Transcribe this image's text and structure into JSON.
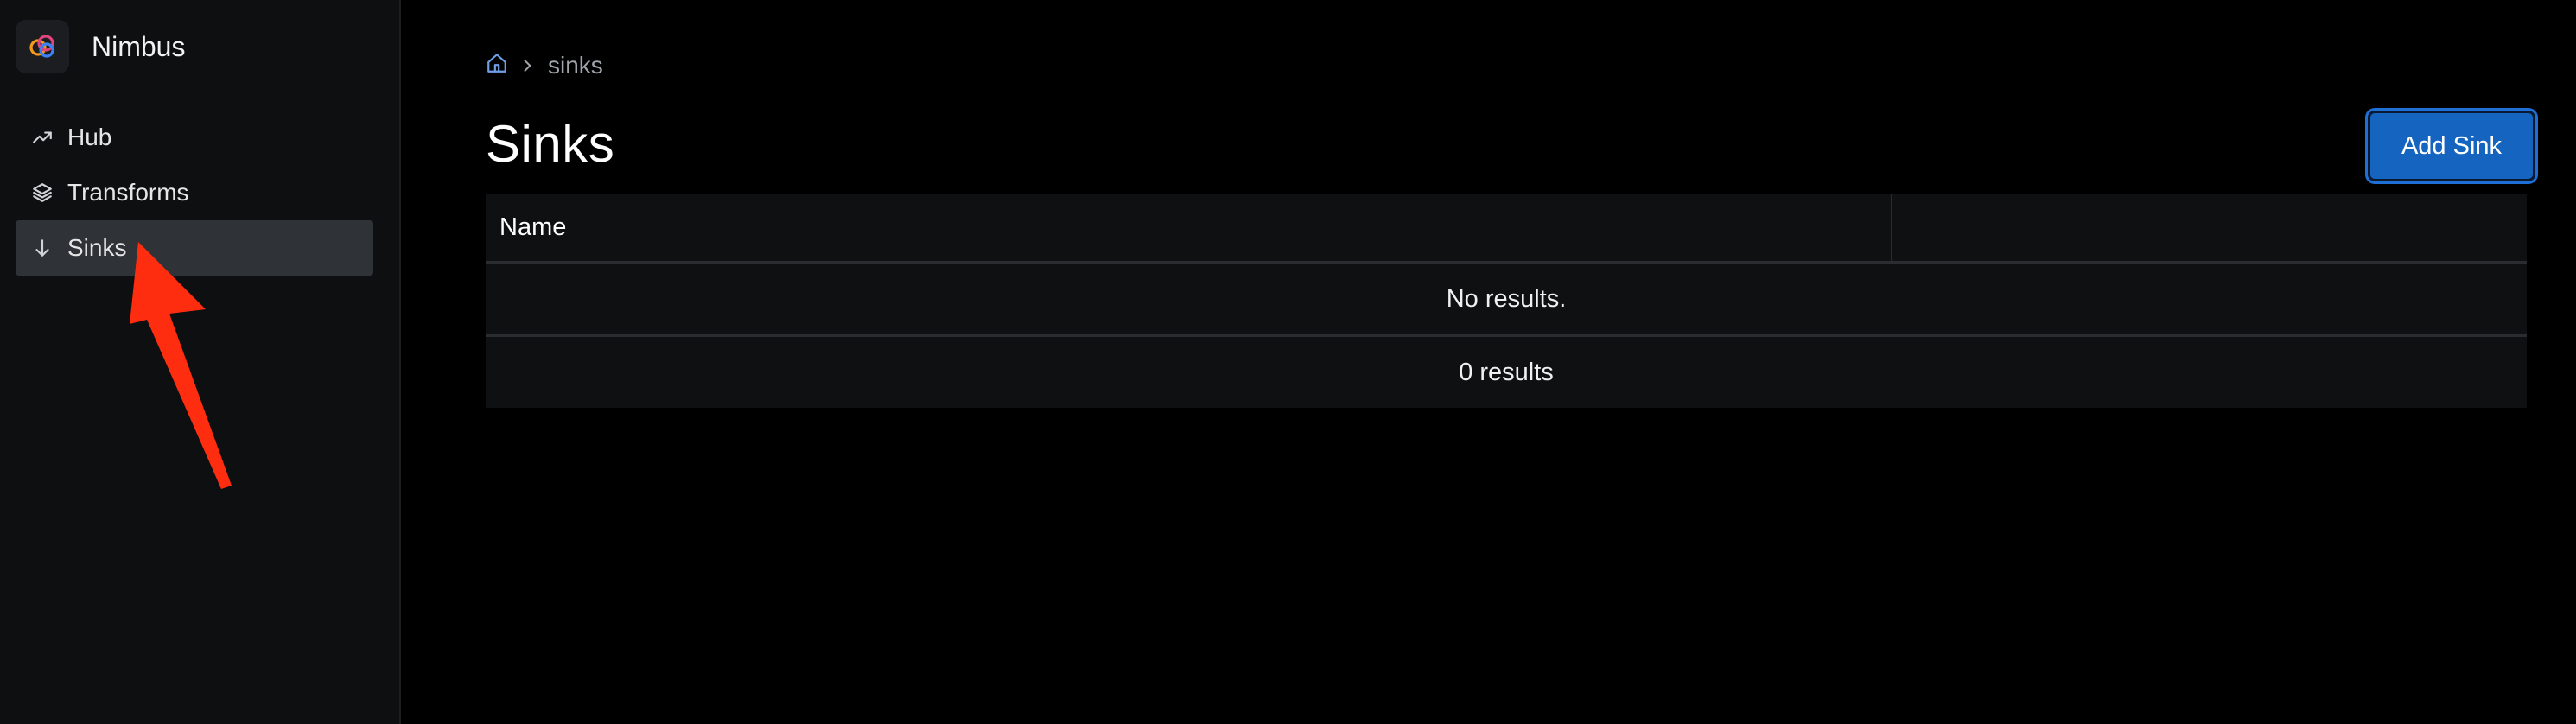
{
  "app": {
    "name": "Nimbus",
    "logo_icon": "nimbus-logo-icon"
  },
  "sidebar": {
    "items": [
      {
        "label": "Hub",
        "icon": "trending-up-icon",
        "active": false
      },
      {
        "label": "Transforms",
        "icon": "layers-icon",
        "active": false
      },
      {
        "label": "Sinks",
        "icon": "arrow-down-icon",
        "active": true
      }
    ]
  },
  "breadcrumb": {
    "home_icon": "home-icon",
    "separator_icon": "chevron-right-icon",
    "current": "sinks"
  },
  "page": {
    "title": "Sinks",
    "add_button_label": "Add Sink"
  },
  "table": {
    "columns": [
      "Name",
      ""
    ],
    "empty_message": "No results.",
    "results_count": "0 results"
  },
  "colors": {
    "accent": "#1565c0",
    "annotation_arrow": "#ff2d10",
    "sidebar_bg": "#0e0f11",
    "active_item_bg": "#2f3237"
  }
}
